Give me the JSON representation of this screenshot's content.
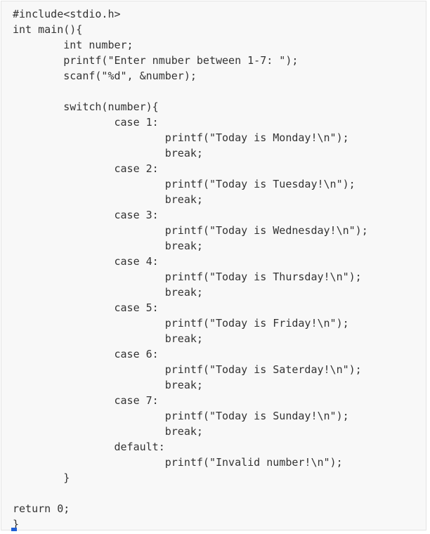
{
  "editor": {
    "lines": [
      "#include<stdio.h>",
      "int main(){",
      "        int number;",
      "        printf(\"Enter nmuber between 1-7: \");",
      "        scanf(\"%d\", &number);",
      "",
      "        switch(number){",
      "                case 1:",
      "                        printf(\"Today is Monday!\\n\");",
      "                        break;",
      "                case 2:",
      "                        printf(\"Today is Tuesday!\\n\");",
      "                        break;",
      "                case 3:",
      "                        printf(\"Today is Wednesday!\\n\");",
      "                        break;",
      "                case 4:",
      "                        printf(\"Today is Thursday!\\n\");",
      "                        break;",
      "                case 5:",
      "                        printf(\"Today is Friday!\\n\");",
      "                        break;",
      "                case 6:",
      "                        printf(\"Today is Saterday!\\n\");",
      "                        break;",
      "                case 7:",
      "                        printf(\"Today is Sunday!\\n\");",
      "                        break;",
      "                default:",
      "                        printf(\"Invalid number!\\n\");",
      "        }",
      "",
      "return 0;",
      "}"
    ]
  }
}
